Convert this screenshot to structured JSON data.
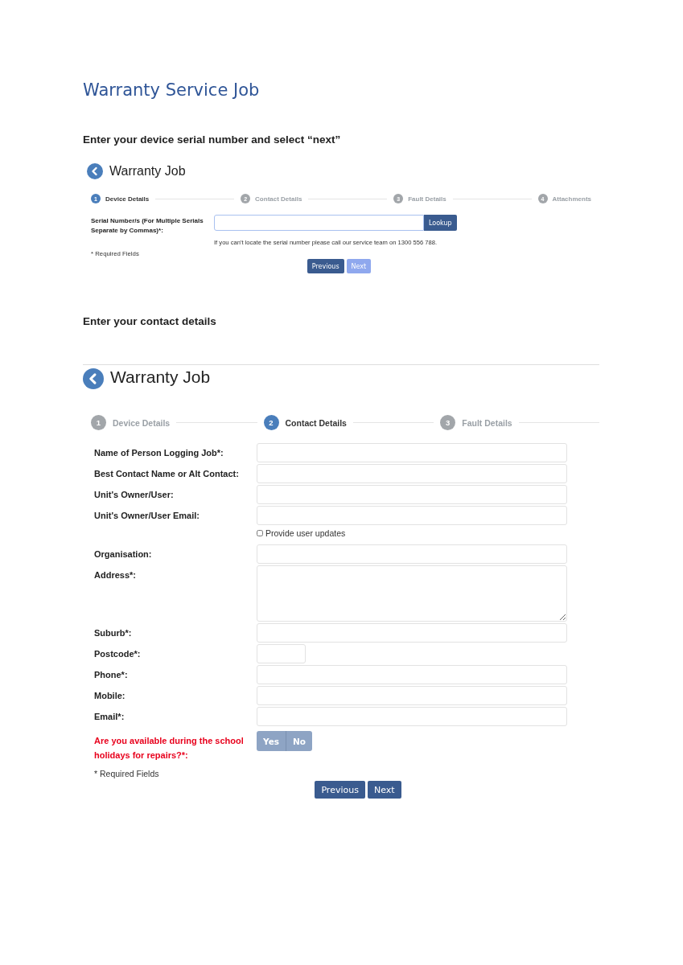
{
  "document": {
    "title": "Warranty Service Job"
  },
  "sections": [
    {
      "heading": "Enter your device serial number and select “next”",
      "panel": {
        "title": "Warranty Job",
        "steps": [
          {
            "number": "1",
            "label": "Device Details",
            "selected": true
          },
          {
            "number": "2",
            "label": "Contact Details",
            "selected": false
          },
          {
            "number": "3",
            "label": "Fault Details",
            "selected": false
          },
          {
            "number": "4",
            "label": "Attachments",
            "selected": false
          }
        ],
        "fields": [
          {
            "kind": "lookup",
            "label": "Serial Number/s (For Multiple Serials Separate by Commas)*:",
            "button": "Lookup",
            "help": "If you can't locate the serial number please call our service team on 1300 556 788."
          }
        ],
        "required_note": "* Required Fields",
        "buttons": [
          {
            "label": "Previous",
            "disabled": false
          },
          {
            "label": "Next",
            "disabled": true
          }
        ]
      }
    },
    {
      "heading": "Enter your contact details",
      "panel": {
        "title": "Warranty Job",
        "steps": [
          {
            "number": "1",
            "label": "Device Details",
            "selected": false
          },
          {
            "number": "2",
            "label": "Contact Details",
            "selected": true
          },
          {
            "number": "3",
            "label": "Fault Details",
            "selected": false
          }
        ],
        "fields": [
          {
            "kind": "input",
            "label": "Name of Person Logging Job*:"
          },
          {
            "kind": "input",
            "label": "Best Contact Name or Alt Contact:"
          },
          {
            "kind": "input",
            "label": "Unit's Owner/User:"
          },
          {
            "kind": "input",
            "label": "Unit's Owner/User Email:"
          },
          {
            "kind": "checkbox",
            "label": "Provide user updates",
            "checked": false
          },
          {
            "kind": "input",
            "label": "Organisation:"
          },
          {
            "kind": "textarea",
            "label": "Address*:"
          },
          {
            "kind": "input",
            "label": "Suburb*:"
          },
          {
            "kind": "short",
            "label": "Postcode*:"
          },
          {
            "kind": "input",
            "label": "Phone*:"
          },
          {
            "kind": "input",
            "label": "Mobile:"
          },
          {
            "kind": "input",
            "label": "Email*:"
          },
          {
            "kind": "toggle",
            "label": "Are you available during the school holidays for repairs?*:",
            "invalid": true,
            "options": [
              "Yes",
              "No"
            ]
          }
        ],
        "required_note": "* Required Fields",
        "buttons": [
          {
            "label": "Previous",
            "disabled": false
          },
          {
            "label": "Next",
            "disabled": false
          }
        ]
      }
    }
  ]
}
